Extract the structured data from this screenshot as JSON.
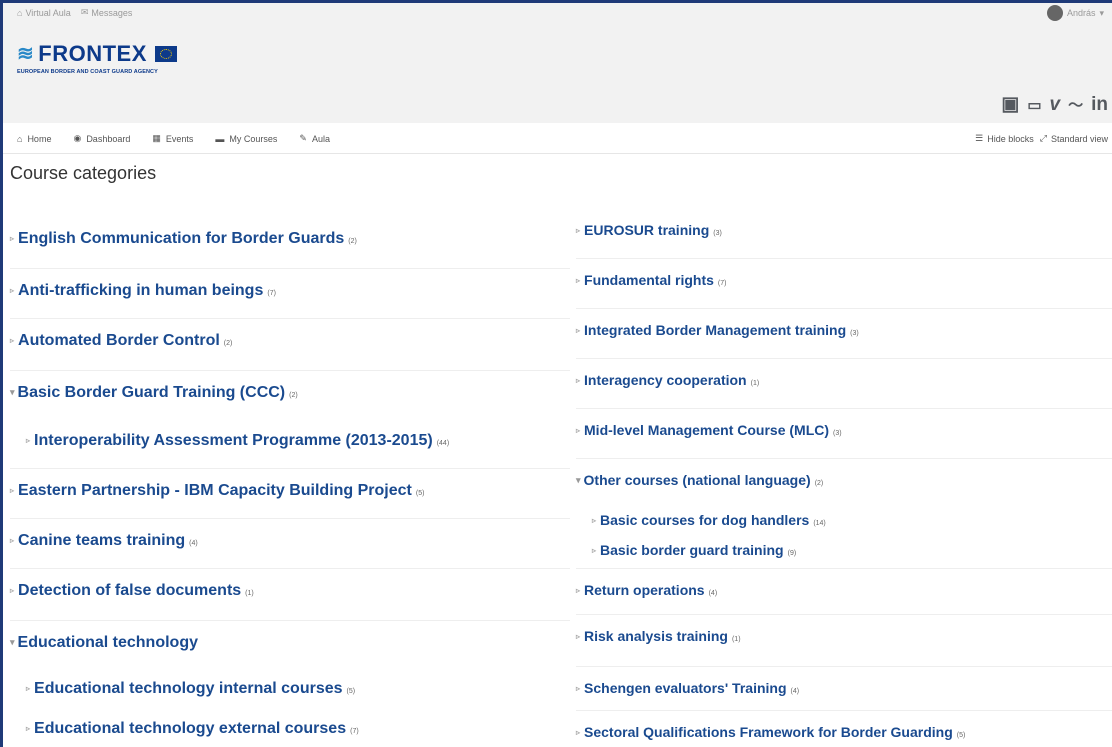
{
  "topbar": {
    "links": [
      {
        "icon": "home-icon",
        "label": "Virtual Aula"
      },
      {
        "icon": "envelope-icon",
        "label": "Messages"
      }
    ],
    "user": "András"
  },
  "brand": {
    "name": "FRONTEX",
    "subtitle": "EUROPEAN BORDER AND COAST GUARD AGENCY",
    "colors": {
      "primary": "#0d3a8a",
      "wave": "#2a89c8",
      "link": "#1a4a8f"
    }
  },
  "social": [
    "square-social-icon",
    "youtube-icon",
    "vimeo-icon",
    "rss-icon",
    "linkedin-icon"
  ],
  "nav": {
    "items": [
      {
        "icon": "home-icon",
        "label": "Home"
      },
      {
        "icon": "dashboard-icon",
        "label": "Dashboard"
      },
      {
        "icon": "calendar-icon",
        "label": "Events"
      },
      {
        "icon": "briefcase-icon",
        "label": "My Courses"
      },
      {
        "icon": "wrench-icon",
        "label": "Aula"
      }
    ],
    "right": [
      {
        "icon": "hide-blocks-icon",
        "label": "Hide blocks"
      },
      {
        "icon": "expand-icon",
        "label": "Standard view"
      }
    ]
  },
  "page": {
    "title": "Course categories"
  },
  "categories": {
    "left": [
      {
        "name": "English Communication for Border Guards",
        "count": "(2)",
        "expanded": false,
        "level": 0
      },
      {
        "name": "Anti-trafficking in human beings",
        "count": "(7)",
        "expanded": false,
        "level": 0
      },
      {
        "name": "Automated Border Control",
        "count": "(2)",
        "expanded": false,
        "level": 0
      },
      {
        "name": "Basic Border Guard Training (CCC)",
        "count": "(2)",
        "expanded": true,
        "level": 0
      },
      {
        "name": "Interoperability Assessment Programme (2013-2015)",
        "count": "(44)",
        "expanded": false,
        "level": 1
      },
      {
        "name": "Eastern Partnership - IBM Capacity Building Project",
        "count": "(5)",
        "expanded": false,
        "level": 0
      },
      {
        "name": "Canine teams training",
        "count": "(4)",
        "expanded": false,
        "level": 0
      },
      {
        "name": "Detection of false documents",
        "count": "(1)",
        "expanded": false,
        "level": 0
      },
      {
        "name": "Educational technology",
        "count": "",
        "expanded": true,
        "level": 0
      },
      {
        "name": "Educational technology internal courses",
        "count": "(5)",
        "expanded": false,
        "level": 1
      },
      {
        "name": "Educational technology external courses",
        "count": "(7)",
        "expanded": false,
        "level": 1
      }
    ],
    "right": [
      {
        "name": "EUROSUR training",
        "count": "(3)",
        "expanded": false,
        "level": 0
      },
      {
        "name": "Fundamental rights",
        "count": "(7)",
        "expanded": false,
        "level": 0
      },
      {
        "name": "Integrated Border Management training",
        "count": "(3)",
        "expanded": false,
        "level": 0
      },
      {
        "name": "Interagency cooperation",
        "count": "(1)",
        "expanded": false,
        "level": 0
      },
      {
        "name": "Mid-level Management Course (MLC)",
        "count": "(3)",
        "expanded": false,
        "level": 0
      },
      {
        "name": "Other courses (national language)",
        "count": "(2)",
        "expanded": true,
        "level": 0
      },
      {
        "name": "Basic courses for dog handlers",
        "count": "(14)",
        "expanded": false,
        "level": 1
      },
      {
        "name": "Basic border guard training",
        "count": "(9)",
        "expanded": false,
        "level": 1
      },
      {
        "name": "Return operations",
        "count": "(4)",
        "expanded": false,
        "level": 0
      },
      {
        "name": "Risk analysis training",
        "count": "(1)",
        "expanded": false,
        "level": 0
      },
      {
        "name": "Schengen evaluators' Training",
        "count": "(4)",
        "expanded": false,
        "level": 0
      },
      {
        "name": "Sectoral Qualifications Framework for Border Guarding",
        "count": "(5)",
        "expanded": false,
        "level": 0
      }
    ]
  }
}
